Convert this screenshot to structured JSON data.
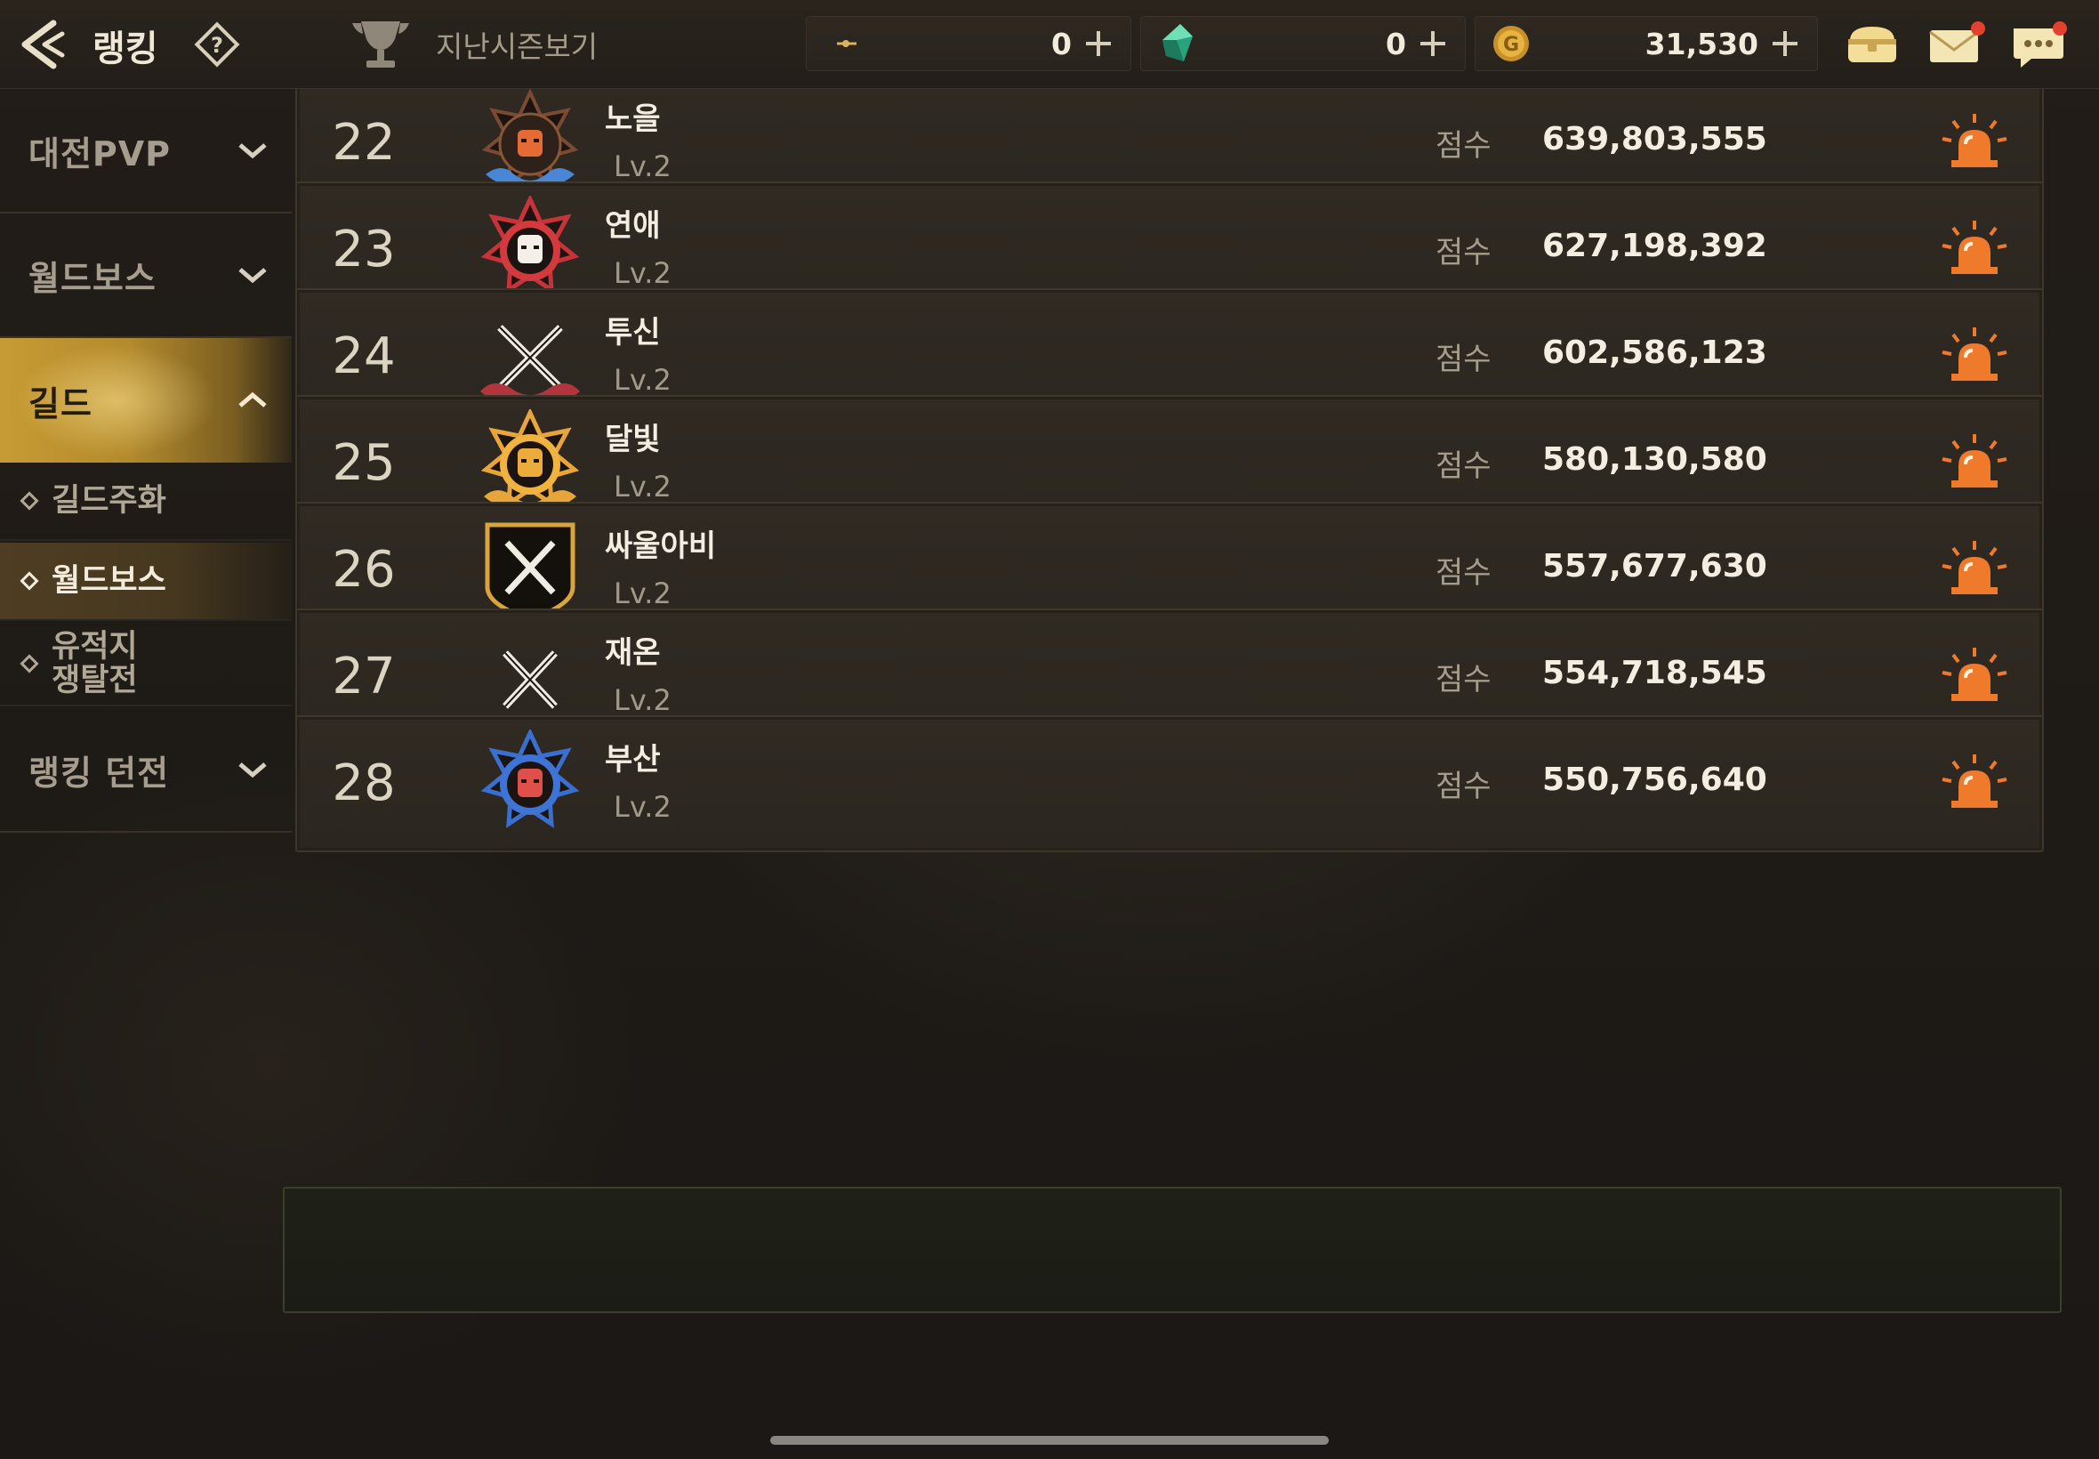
{
  "header": {
    "title": "랭킹",
    "last_season_label": "지난시즌보기",
    "currencies": [
      {
        "icon": "crescent-token-icon",
        "amount": "0"
      },
      {
        "icon": "green-crystal-icon",
        "amount": "0"
      },
      {
        "icon": "gold-coin-icon",
        "amount": "31,530"
      }
    ],
    "icons": [
      "chest-icon",
      "mail-icon",
      "chat-icon"
    ]
  },
  "sidebar": {
    "menus": [
      {
        "label": "대전PVP",
        "expanded": false
      },
      {
        "label": "월드보스",
        "expanded": false
      },
      {
        "label": "길드",
        "expanded": true,
        "active": true
      },
      {
        "label": "랭킹 던전",
        "expanded": false
      }
    ],
    "guild_submenu": [
      {
        "label": "길드주화",
        "selected": false
      },
      {
        "label": "월드보스",
        "selected": true
      },
      {
        "label": "유적지\n쟁탈전",
        "selected": false
      }
    ]
  },
  "ranking": {
    "score_label": "점수",
    "rows": [
      {
        "rank": "22",
        "name": "노을",
        "level": "Lv.2",
        "score": "639,803,555",
        "emblem": "brown-star-wave-emblem"
      },
      {
        "rank": "23",
        "name": "연애",
        "level": "Lv.2",
        "score": "627,198,392",
        "emblem": "red-star-emblem"
      },
      {
        "rank": "24",
        "name": "투신",
        "level": "Lv.2",
        "score": "602,586,123",
        "emblem": "crossed-swords-red-wave-emblem"
      },
      {
        "rank": "25",
        "name": "달빛",
        "level": "Lv.2",
        "score": "580,130,580",
        "emblem": "gold-star-emblem"
      },
      {
        "rank": "26",
        "name": "싸울아비",
        "level": "Lv.2",
        "score": "557,677,630",
        "emblem": "gold-shield-swords-emblem"
      },
      {
        "rank": "27",
        "name": "재온",
        "level": "Lv.2",
        "score": "554,718,545",
        "emblem": "crossed-swords-emblem"
      },
      {
        "rank": "28",
        "name": "부산",
        "level": "Lv.2",
        "score": "550,756,640",
        "emblem": "blue-star-emblem"
      }
    ]
  },
  "colors": {
    "accent_gold": "#c79b34",
    "report_orange": "#ef7a2c",
    "notification_red": "#e5402e"
  }
}
